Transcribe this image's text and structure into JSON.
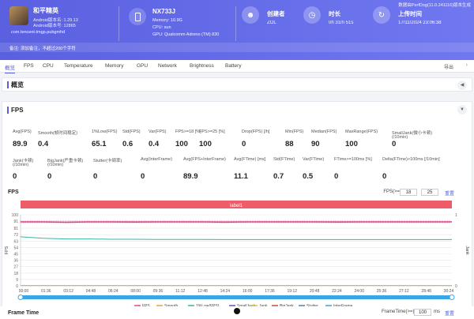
{
  "header": {
    "version": "数据由PerfDog(11.0.241116)版本生成",
    "game": {
      "name": "和平精英",
      "version_label": "Android版本名: 1.29.13",
      "version_code": "Android版本号: 12865",
      "package": "com.tencent.tmgp.pubgmhd"
    },
    "device": {
      "name": "NX733J",
      "memory": "Memory: 10.9G",
      "cpu": "CPU: sun",
      "gpu": "GPU: Qualcomm Adreno (TM) 830"
    },
    "creator": {
      "label": "创建者",
      "value": "ZOL"
    },
    "duration": {
      "label": "时长",
      "value": "0h 31m 51s"
    },
    "upload": {
      "label": "上传时间",
      "value": "17/11/2024 23:06:38"
    },
    "note": "备注: 添加备注，不超过200个字符"
  },
  "tabs": [
    "概览",
    "FPS",
    "CPU",
    "Temperature",
    "Memory",
    "GPU",
    "Network",
    "Brightness",
    "Battery"
  ],
  "export_label": "导出",
  "overview": {
    "title": "概览"
  },
  "fps_section": {
    "title": "FPS"
  },
  "metrics_row1": [
    {
      "label": "Avg(FPS)",
      "value": "89.9"
    },
    {
      "label": "Smooth(帧时间稳定)",
      "value": "0.4"
    },
    {
      "label": "1%Low(FPS)",
      "value": "65.1"
    },
    {
      "label": "Std(FPS)",
      "value": "0.6"
    },
    {
      "label": "Var(FPS)",
      "value": "0.4"
    },
    {
      "label": "FPS>=18 [%]",
      "value": "100"
    },
    {
      "label": "FPS>=25 [%]",
      "value": "100"
    },
    {
      "label": "Drop(FPS) [/h]",
      "value": "0"
    },
    {
      "label": "Min(FPS)",
      "value": "88"
    },
    {
      "label": "Median(FPS)",
      "value": "90"
    },
    {
      "label": "MaxRange(FPS)",
      "value": "100"
    },
    {
      "label": "SmallJank(微小卡顿)",
      "label2": "(/10min)",
      "value": "0"
    }
  ],
  "metrics_row2": [
    {
      "label": "Jank(卡顿)",
      "label2": "(/10min)",
      "value": "0"
    },
    {
      "label": "BigJank(严重卡顿)",
      "label2": "(/10min)",
      "value": "0"
    },
    {
      "label": "Stutter(卡顿率)",
      "value": "0"
    },
    {
      "label": "Avg(InterFrame)",
      "value": "0"
    },
    {
      "label": "Avg(FPS+InterFrame)",
      "value": "89.9"
    },
    {
      "label": "Avg(FTime) [ms]",
      "value": "11.1"
    },
    {
      "label": "Std(FTime)",
      "value": "0.7"
    },
    {
      "label": "Var(FTime)",
      "value": "0.5"
    },
    {
      "label": "FTime>=100ms [%]",
      "value": "0"
    },
    {
      "label": "Delta(FTime)>100ms [/10min]",
      "value": "0"
    }
  ],
  "chart_controls": {
    "title": "FPS",
    "fps_filter_label": "FPS(>=)",
    "fps_val1": "18",
    "fps_val2": "25",
    "reset": "重置"
  },
  "chart_data": {
    "type": "line",
    "label_bar": "label1",
    "ylabel_left": "FPS",
    "ylabel_right": "Jank",
    "yticks": [
      0,
      9,
      18,
      27,
      36,
      45,
      54,
      63,
      72,
      81,
      91,
      100
    ],
    "right_ticks": [
      0,
      1
    ],
    "xticks": [
      "00:00",
      "01:36",
      "03:12",
      "04:48",
      "06:24",
      "08:00",
      "09:36",
      "11:12",
      "12:48",
      "14:24",
      "16:00",
      "17:36",
      "19:12",
      "20:48",
      "22:24",
      "24:00",
      "25:36",
      "27:12",
      "28:48",
      "30:24"
    ],
    "ylim": [
      0,
      100
    ],
    "series": [
      {
        "name": "FPS",
        "color": "#e0458f",
        "values": [
          90,
          90,
          89.5,
          90,
          90,
          89.8,
          90,
          90,
          90,
          89.7,
          90,
          90,
          90,
          90,
          89.8,
          90,
          90,
          90,
          90,
          90
        ]
      },
      {
        "name": "Smooth",
        "color": "#e8a040",
        "values": [
          0.4,
          0.4,
          0.4,
          0.4,
          0.4,
          0.4,
          0.4,
          0.4,
          0.4,
          0.4,
          0.4,
          0.4,
          0.4,
          0.4,
          0.4,
          0.4,
          0.4,
          0.4,
          0.4,
          0.4
        ]
      },
      {
        "name": "1%Low(FPS)",
        "color": "#3bb5a0",
        "values": [
          69,
          67,
          66,
          66,
          65.5,
          65.5,
          65.3,
          65.2,
          65.2,
          65.1,
          65.1,
          65.1,
          65.1,
          65.1,
          65.1,
          65.1,
          65.1,
          65.1,
          65.1,
          65.1
        ]
      },
      {
        "name": "SmallJank",
        "color": "#6a4bc0",
        "values": []
      },
      {
        "name": "Jank",
        "color": "#e0c040",
        "values": []
      },
      {
        "name": "BigJank",
        "color": "#c0502a",
        "values": []
      },
      {
        "name": "Stutter",
        "color": "#5a7a9a",
        "values": []
      },
      {
        "name": "InterFrame",
        "color": "#3aa0e0",
        "values": []
      }
    ]
  },
  "footer": {
    "title": "Frame Time",
    "ftime_label": "FrameTime(>=)",
    "ftime_value": "100",
    "ftime_unit": "ms",
    "reset": "重置"
  }
}
